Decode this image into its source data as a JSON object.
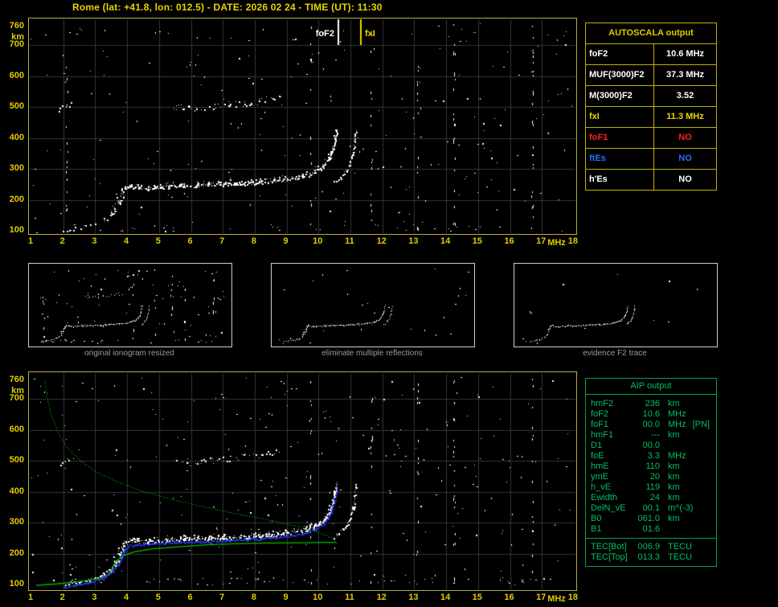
{
  "title": "Rome (lat: +41.8, lon: 012.5) - DATE: 2026 02 24 - TIME (UT): 11:30",
  "colors": {
    "background": "#000000",
    "axis_text": "#e0cc00",
    "plot_border": "#b8ac44",
    "grid": "#373737",
    "data_points": "#ffffff",
    "fof2_marker": "#ffffff",
    "fxi_marker": "#ecd800",
    "profile_green": "#00c000",
    "trace_blue": "#2638e8",
    "autoscala_border": "#c0b000",
    "aip_green": "#00c060",
    "caption_gray": "#9a9a9a",
    "value_white": "#ffffff",
    "value_red": "#ff2020",
    "value_blue": "#2b6bff",
    "value_yellow": "#e8d400"
  },
  "axes": {
    "x_ticks": [
      1,
      2,
      3,
      4,
      5,
      6,
      7,
      8,
      9,
      10,
      11,
      12,
      13,
      14,
      15,
      16,
      17,
      18
    ],
    "x_unit": "MHz",
    "y_ticks": [
      760,
      700,
      600,
      500,
      400,
      300,
      200,
      100
    ],
    "y_unit": "km"
  },
  "main_plot": {
    "fof2_label": "foF2",
    "fxi_label": "fxI"
  },
  "autoscala_table": {
    "header": "AUTOSCALA output",
    "rows": [
      {
        "label": "foF2",
        "value": "10.6 MHz",
        "color": "#ffffff"
      },
      {
        "label": "MUF(3000)F2",
        "value": "37.3 MHz",
        "color": "#ffffff"
      },
      {
        "label": "M(3000)F2",
        "value": "3.52",
        "color": "#ffffff"
      },
      {
        "label": "fxI",
        "value": "11.3 MHz",
        "color": "#e8d400"
      },
      {
        "label": "foF1",
        "value": "NO",
        "color": "#ff2020"
      },
      {
        "label": "ftEs",
        "value": "NO",
        "color": "#2b6bff"
      },
      {
        "label": "h'Es",
        "value": "NO",
        "color": "#ffffff"
      }
    ]
  },
  "thumbnails": [
    {
      "caption": "original ionogram resized"
    },
    {
      "caption": "eliminate multiple reflections"
    },
    {
      "caption": "evidence F2 trace"
    }
  ],
  "aip_table": {
    "header": "AIP output",
    "rows": [
      {
        "name": "hmF2",
        "value": "236",
        "unit": "km",
        "extra": ""
      },
      {
        "name": "foF2",
        "value": "10.6",
        "unit": "MHz",
        "extra": ""
      },
      {
        "name": "foF1",
        "value": "00.0",
        "unit": "MHz",
        "extra": "[PN]"
      },
      {
        "name": "hmF1",
        "value": "---",
        "unit": "km",
        "extra": ""
      },
      {
        "name": "D1",
        "value": "00.0",
        "unit": "",
        "extra": ""
      },
      {
        "name": "foE",
        "value": "3.3",
        "unit": "MHz",
        "extra": ""
      },
      {
        "name": "hmE",
        "value": "110",
        "unit": "km",
        "extra": ""
      },
      {
        "name": "ymE",
        "value": "20",
        "unit": "km",
        "extra": ""
      },
      {
        "name": "h_vE",
        "value": "119",
        "unit": "km",
        "extra": ""
      },
      {
        "name": "Ewidth",
        "value": "24",
        "unit": "km",
        "extra": ""
      },
      {
        "name": "DelN_vE",
        "value": "00.1",
        "unit": "m^(-3)",
        "extra": ""
      },
      {
        "name": "B0",
        "value": "061.0",
        "unit": "km",
        "extra": ""
      },
      {
        "name": "B1",
        "value": "01.6",
        "unit": "",
        "extra": ""
      }
    ],
    "tec_rows": [
      {
        "name": "TEC[Bot]",
        "value": "006.9",
        "unit": "TECU"
      },
      {
        "name": "TEC[Top]",
        "value": "013.3",
        "unit": "TECU"
      }
    ]
  },
  "chart_data": {
    "type": "scatter",
    "title": "Ionogram with AUTOSCALA interpretation",
    "xlabel": "MHz",
    "ylabel": "km",
    "xlim": [
      1,
      18
    ],
    "ylim": [
      100,
      760
    ],
    "grid": true,
    "markers": {
      "foF2_mhz": 10.6,
      "fxI_mhz": 11.3
    },
    "traces": {
      "e_region": [
        [
          1.9,
          101
        ],
        [
          2.3,
          106
        ],
        [
          2.7,
          113
        ],
        [
          3.0,
          122
        ],
        [
          3.25,
          133
        ],
        [
          3.45,
          147
        ],
        [
          3.6,
          163
        ],
        [
          3.7,
          179
        ]
      ],
      "f2_cusp": [
        [
          3.72,
          186
        ],
        [
          3.78,
          202
        ],
        [
          3.83,
          217
        ],
        [
          3.89,
          230
        ],
        [
          3.97,
          240
        ],
        [
          4.05,
          245
        ]
      ],
      "cusp_cloud": [
        [
          3.5,
          152
        ],
        [
          3.65,
          183
        ],
        [
          3.78,
          208
        ],
        [
          3.9,
          232
        ]
      ],
      "f2_ordinary": [
        [
          4.05,
          244
        ],
        [
          4.35,
          240
        ],
        [
          4.65,
          238
        ],
        [
          5.0,
          241
        ],
        [
          5.4,
          244
        ],
        [
          5.8,
          246
        ],
        [
          6.2,
          247
        ],
        [
          6.6,
          248
        ],
        [
          7.0,
          250
        ],
        [
          7.4,
          252
        ],
        [
          7.8,
          254
        ],
        [
          8.2,
          257
        ],
        [
          8.6,
          261
        ],
        [
          9.0,
          266
        ],
        [
          9.3,
          271
        ],
        [
          9.6,
          279
        ],
        [
          9.85,
          288
        ],
        [
          10.05,
          300
        ],
        [
          10.2,
          315
        ],
        [
          10.35,
          338
        ],
        [
          10.45,
          365
        ],
        [
          10.52,
          398
        ],
        [
          10.56,
          424
        ]
      ],
      "f2_extraordinary": [
        [
          10.48,
          256
        ],
        [
          10.62,
          266
        ],
        [
          10.76,
          280
        ],
        [
          10.9,
          299
        ],
        [
          11.0,
          323
        ],
        [
          11.08,
          352
        ],
        [
          11.13,
          388
        ],
        [
          11.16,
          420
        ]
      ],
      "second_hop": [
        [
          5.5,
          497
        ],
        [
          5.9,
          503
        ],
        [
          6.3,
          499
        ],
        [
          6.8,
          504
        ],
        [
          7.2,
          508
        ],
        [
          7.7,
          514
        ],
        [
          8.1,
          520
        ],
        [
          8.5,
          528
        ],
        [
          8.8,
          537
        ]
      ],
      "e_second_hop": [
        [
          1.85,
          492
        ],
        [
          2.05,
          503
        ],
        [
          2.25,
          513
        ]
      ]
    },
    "restored_trace": [
      [
        2.0,
        102
      ],
      [
        2.4,
        107
      ],
      [
        2.8,
        115
      ],
      [
        3.1,
        125
      ],
      [
        3.35,
        138
      ],
      [
        3.55,
        153
      ],
      [
        3.7,
        171
      ],
      [
        3.8,
        193
      ],
      [
        3.9,
        216
      ],
      [
        4.0,
        233
      ],
      [
        4.3,
        238
      ],
      [
        4.8,
        241
      ],
      [
        5.4,
        244
      ],
      [
        6.0,
        246
      ],
      [
        6.6,
        248
      ],
      [
        7.2,
        251
      ],
      [
        7.8,
        254
      ],
      [
        8.4,
        259
      ],
      [
        9.0,
        265
      ],
      [
        9.5,
        274
      ],
      [
        9.9,
        288
      ],
      [
        10.15,
        305
      ],
      [
        10.3,
        325
      ],
      [
        10.42,
        350
      ],
      [
        10.5,
        382
      ],
      [
        10.56,
        418
      ]
    ],
    "profile_bottomside": [
      [
        1.15,
        97
      ],
      [
        1.8,
        102
      ],
      [
        2.4,
        108
      ],
      [
        2.9,
        115
      ],
      [
        3.2,
        122
      ],
      [
        3.4,
        132
      ],
      [
        3.5,
        145
      ],
      [
        3.57,
        160
      ],
      [
        3.67,
        176
      ],
      [
        3.85,
        192
      ],
      [
        4.2,
        205
      ],
      [
        4.8,
        215
      ],
      [
        5.6,
        222
      ],
      [
        6.5,
        228
      ],
      [
        7.5,
        232
      ],
      [
        8.5,
        234
      ],
      [
        9.5,
        235
      ],
      [
        10.2,
        236
      ],
      [
        10.55,
        236
      ]
    ],
    "profile_topside": [
      [
        10.55,
        236
      ],
      [
        10.45,
        249
      ],
      [
        10.2,
        262
      ],
      [
        9.8,
        276
      ],
      [
        9.2,
        292
      ],
      [
        8.4,
        310
      ],
      [
        7.4,
        330
      ],
      [
        6.4,
        352
      ],
      [
        5.4,
        376
      ],
      [
        4.5,
        402
      ],
      [
        3.7,
        432
      ],
      [
        3.0,
        466
      ],
      [
        2.5,
        502
      ],
      [
        2.1,
        545
      ],
      [
        1.82,
        592
      ],
      [
        1.62,
        645
      ],
      [
        1.5,
        700
      ],
      [
        1.42,
        758
      ]
    ],
    "noise_streak_freqs": [
      2.1,
      9.75,
      11.65,
      13.1,
      14.25,
      16.7
    ]
  }
}
